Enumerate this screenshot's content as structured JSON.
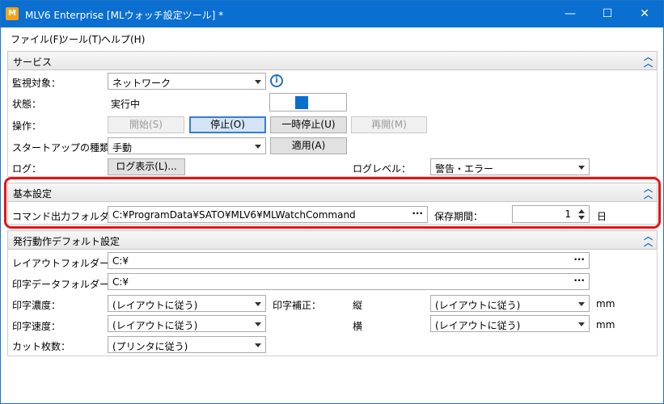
{
  "window": {
    "title": "MLV6 Enterprise [MLウォッチ設定ツール] *",
    "app_icon_glyph": "M",
    "minimize_glyph": "—",
    "maximize_glyph": "☐",
    "close_glyph": "✕"
  },
  "menu": [
    "ファイル(F)",
    "ツール(T)",
    "ヘルプ(H)"
  ],
  "service": {
    "header": "サービス",
    "target_label": "監視対象：",
    "target_value": "ネットワーク",
    "status_label": "状態：",
    "status_value": "実行中",
    "op_label": "操作：",
    "buttons": {
      "start": "開始(S)",
      "stop": "停止(O)",
      "pause": "一時停止(U)",
      "resume": "再開(M)"
    },
    "startup_label": "スタートアップの種類：",
    "startup_value": "手動",
    "apply_button": "適用(A)",
    "log_label": "ログ：",
    "log_button": "ログ表示(L)...",
    "loglevel_label": "ログレベル：",
    "loglevel_value": "警告・エラー"
  },
  "basic": {
    "header": "基本設定",
    "cmd_folder_label": "コマンド出力フォルダー：",
    "cmd_folder_value": "C:¥ProgramData¥SATO¥MLV6¥MLWatchCommand",
    "browse_glyph": "···",
    "retention_label": "保存期間：",
    "retention_value": "1",
    "retention_unit": "日"
  },
  "issue": {
    "header": "発行動作デフォルト設定",
    "layout_folder_label": "レイアウトフォルダー：",
    "layout_folder_value": "C:¥",
    "data_folder_label": "印字データフォルダー：",
    "data_folder_value": "C:¥",
    "density_label": "印字濃度：",
    "density_value": "(レイアウトに従う)",
    "correction_label": "印字補正：",
    "vertical_label": "縦",
    "vertical_value": "(レイアウトに従う)",
    "horizontal_label": "横",
    "horizontal_value": "(レイアウトに従う)",
    "unit": "mm",
    "speed_label": "印字速度：",
    "speed_value": "(レイアウトに従う)",
    "cut_label": "カット枚数：",
    "cut_value": "(プリンタに従う)"
  },
  "colors": {
    "accent": "#0a6fd0",
    "highlight": "#e21515"
  }
}
